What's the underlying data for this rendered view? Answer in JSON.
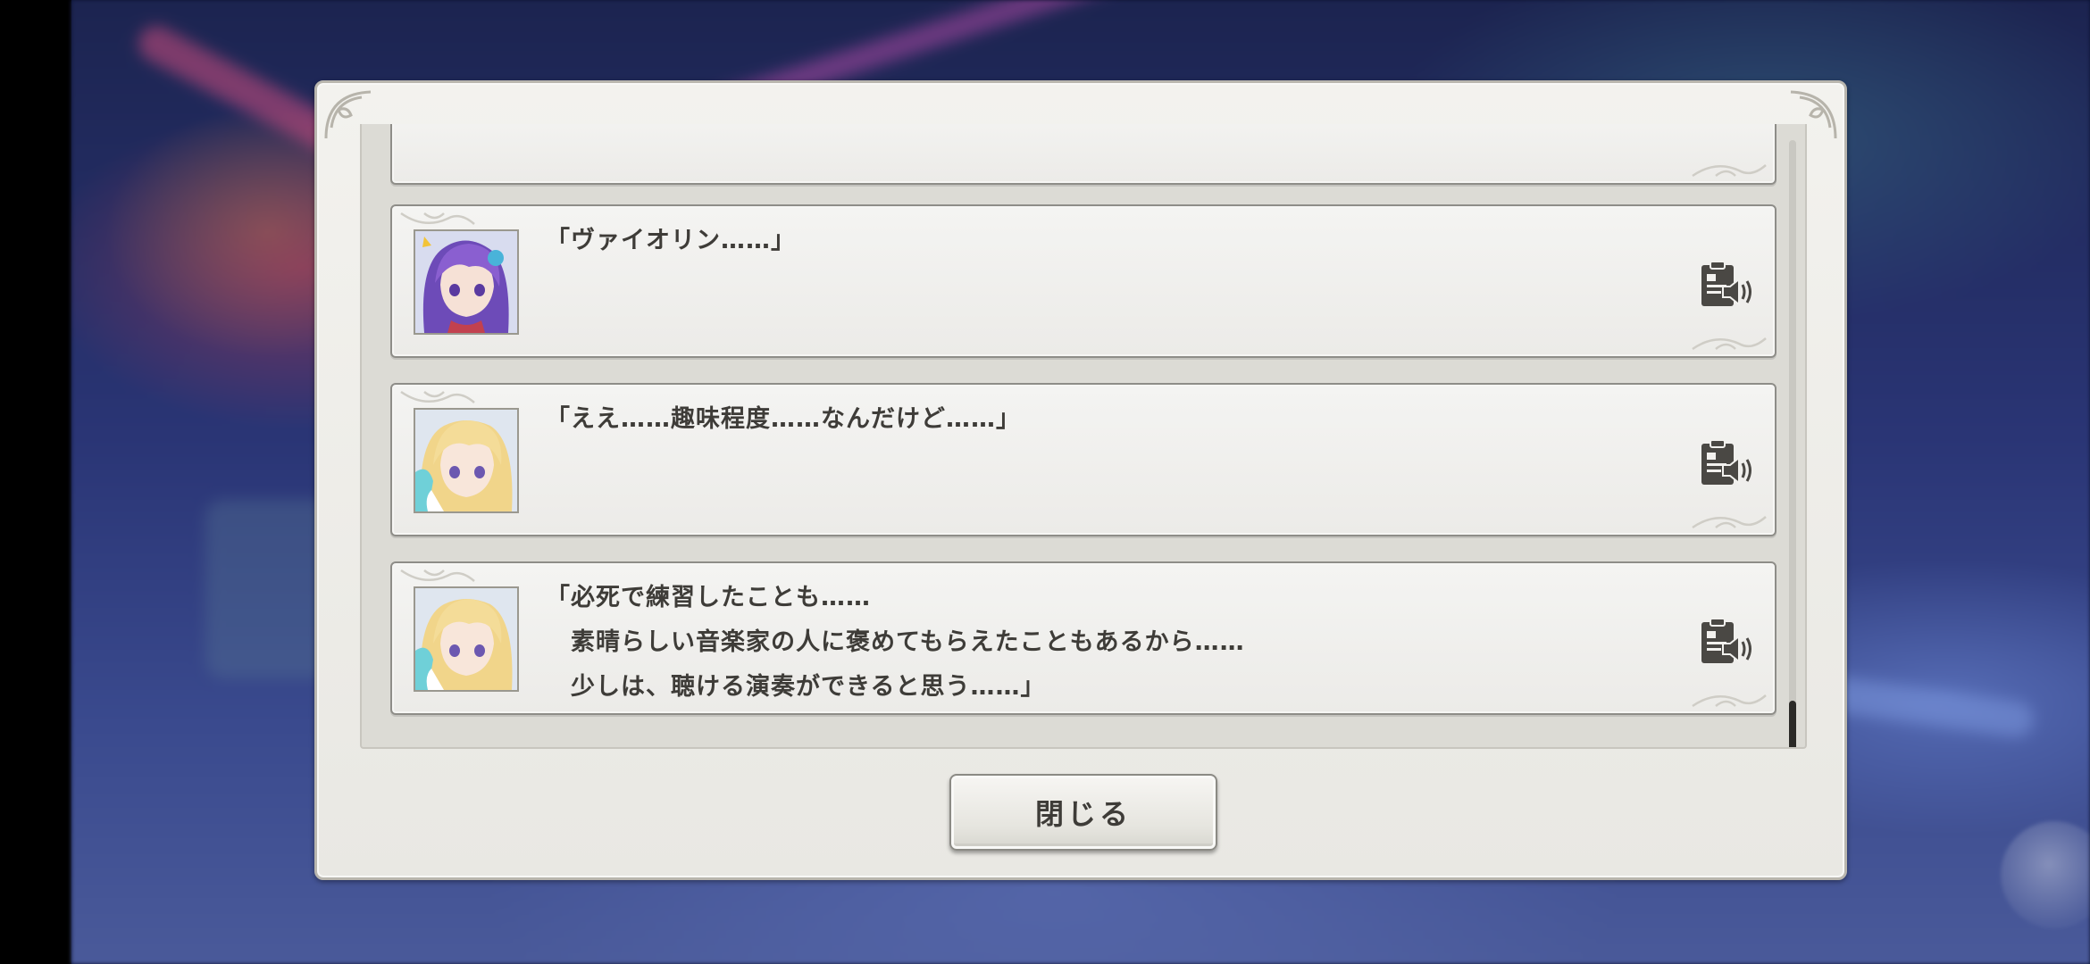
{
  "dialog": {
    "close_label": "閉じる"
  },
  "log": {
    "entries": [
      {
        "speaker_avatar": "purple-haired-girl-avatar",
        "lines": [
          "「ヴァイオリン……」"
        ]
      },
      {
        "speaker_avatar": "blonde-girl-avatar",
        "lines": [
          "「ええ……趣味程度……なんだけど……」"
        ]
      },
      {
        "speaker_avatar": "blonde-girl-avatar",
        "lines": [
          "「必死で練習したことも……",
          "　素晴らしい音楽家の人に褒めてもらえたこともあるから……",
          "　少しは、聴ける演奏ができると思う……」"
        ]
      }
    ]
  },
  "icons": {
    "voice": "voice-replay-icon"
  },
  "colors": {
    "panel": "#eceae6",
    "border": "#8e8d88",
    "text": "#3e3c38",
    "scroll_thumb": "#2b2a27"
  }
}
